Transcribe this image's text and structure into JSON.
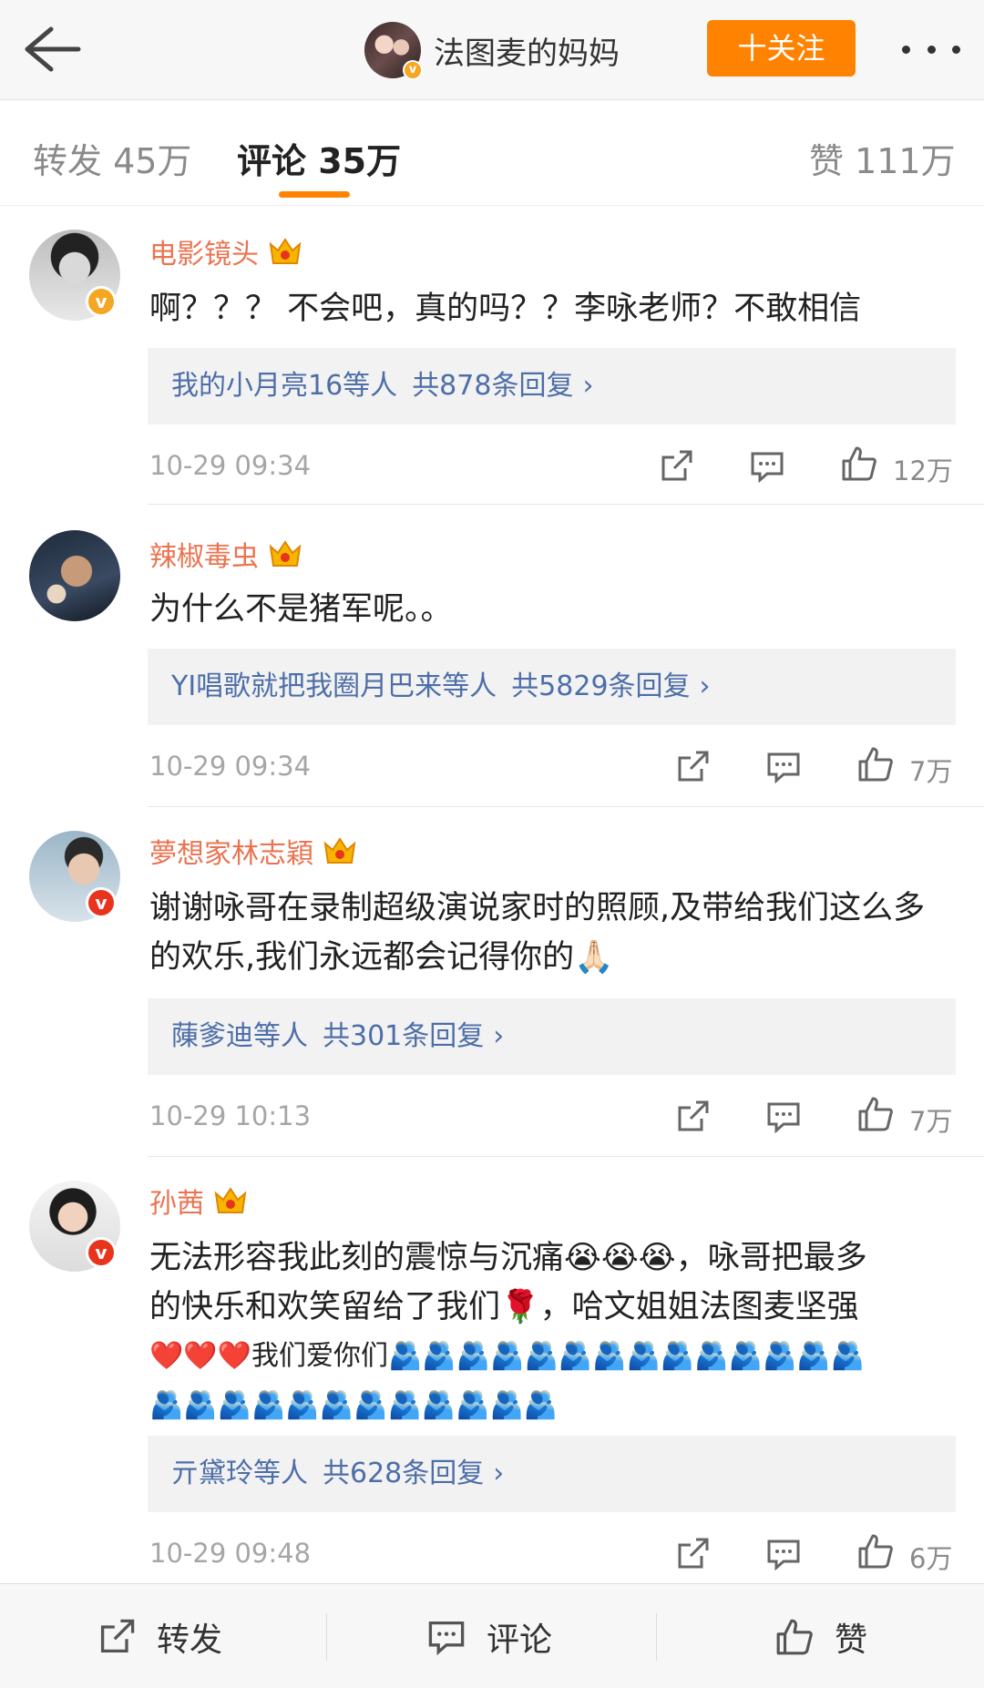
{
  "header": {
    "author_name": "法图麦的妈妈",
    "follow_label": "十关注"
  },
  "tabs": {
    "repost": "转发 45万",
    "comments": "评论 35万",
    "likes": "赞 111万"
  },
  "comments": [
    {
      "name": "电影镜头",
      "text": "啊？？？ 不会吧，真的吗？？李咏老师？不敢相信",
      "reply_names": "我的小月亮16等人",
      "reply_count": "共878条回复",
      "time": "10-29 09:34",
      "likes": "12万"
    },
    {
      "name": "辣椒毒虫",
      "text": "为什么不是猪军呢。。",
      "reply_names": "YI唱歌就把我圈月巴来等人",
      "reply_count": "共5829条回复",
      "time": "10-29 09:34",
      "likes": "7万"
    },
    {
      "name": "夢想家林志穎",
      "text": "谢谢咏哥在录制超级演说家时的照顾,及带给我们这么多的欢乐,我们永远都会记得你的🙏🏻",
      "reply_names": "蔯爹迪等人",
      "reply_count": "共301条回复",
      "time": "10-29 10:13",
      "likes": "7万"
    },
    {
      "name": "孙茜",
      "text_line1": "无法形容我此刻的震惊与沉痛😭😭😭，咏哥把最多",
      "text_line2": "的快乐和欢笑留给了我们🌹，哈文姐姐法图麦坚强",
      "text_line3": "❤️❤️❤️我们爱你们🫂🫂🫂🫂🫂🫂🫂🫂🫂🫂🫂🫂🫂🫂",
      "text_line4": "🫂🫂🫂🫂🫂🫂🫂🫂🫂🫂🫂🫂",
      "reply_names": "亓黛玲等人",
      "reply_count": "共628条回复",
      "time": "10-29 09:48",
      "likes": "6万"
    }
  ],
  "bottom": {
    "repost": "转发",
    "comment": "评论",
    "like": "赞"
  },
  "colors": {
    "accent": "#ff8200",
    "name": "#eb7350",
    "link": "#4d6ea8"
  }
}
